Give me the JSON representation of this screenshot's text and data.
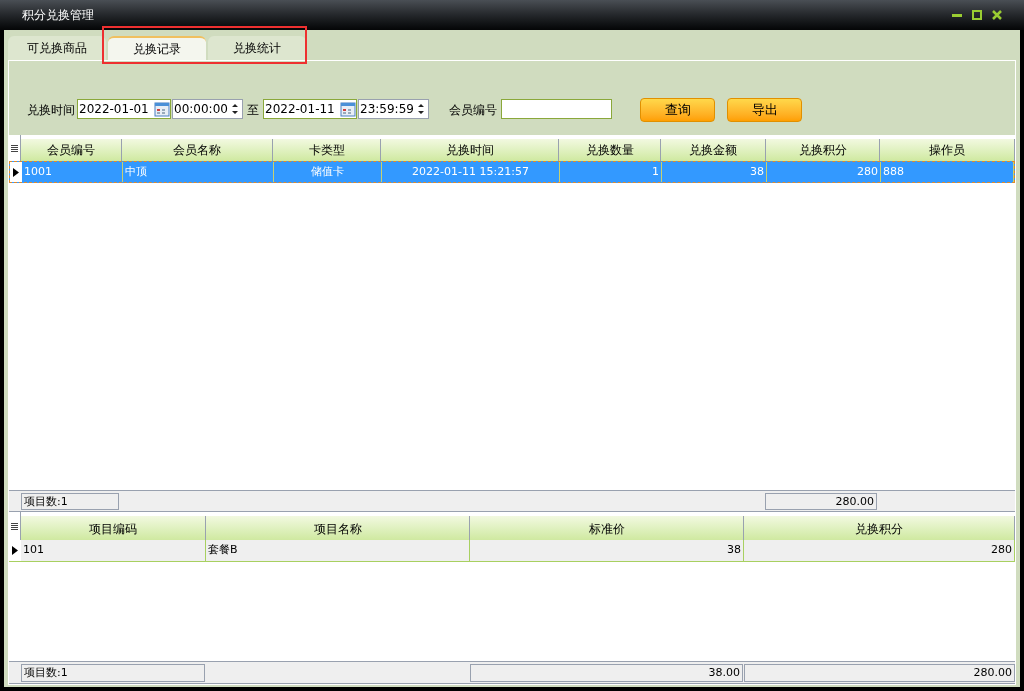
{
  "window": {
    "title": "积分兑换管理"
  },
  "tabs": [
    {
      "label": "可兑换商品",
      "selected": false
    },
    {
      "label": "兑换记录",
      "selected": true
    },
    {
      "label": "兑换统计",
      "selected": false
    }
  ],
  "filter": {
    "time_label": "兑换时间",
    "start_date": "2022-01-01",
    "start_time": "00:00:00",
    "to_label": "至",
    "end_date": "2022-01-11",
    "end_time": "23:59:59",
    "member_label": "会员编号",
    "buttons": [
      "查询",
      "导出"
    ]
  },
  "records": {
    "columns": [
      "会员编号",
      "会员名称",
      "卡类型",
      "兑换时间",
      "兑换数量",
      "兑换金额",
      "兑换积分",
      "操作员"
    ],
    "rows": [
      {
        "cells": [
          "1001",
          "中顶",
          "储值卡",
          "2022-01-11 15:21:57",
          "1",
          "38",
          "280",
          "888"
        ],
        "selected": true,
        "current": true
      }
    ],
    "footer": {
      "count": "项目数:1",
      "points_total": "280.00"
    }
  },
  "items": {
    "columns": [
      "项目编码",
      "项目名称",
      "标准价",
      "兑换积分"
    ],
    "rows": [
      {
        "cells": [
          "101",
          "套餐B",
          "38",
          "280"
        ],
        "selected": false,
        "current": true
      }
    ],
    "footer": {
      "count": "项目数:1",
      "price_total": "38.00",
      "points_total": "280.00"
    }
  }
}
